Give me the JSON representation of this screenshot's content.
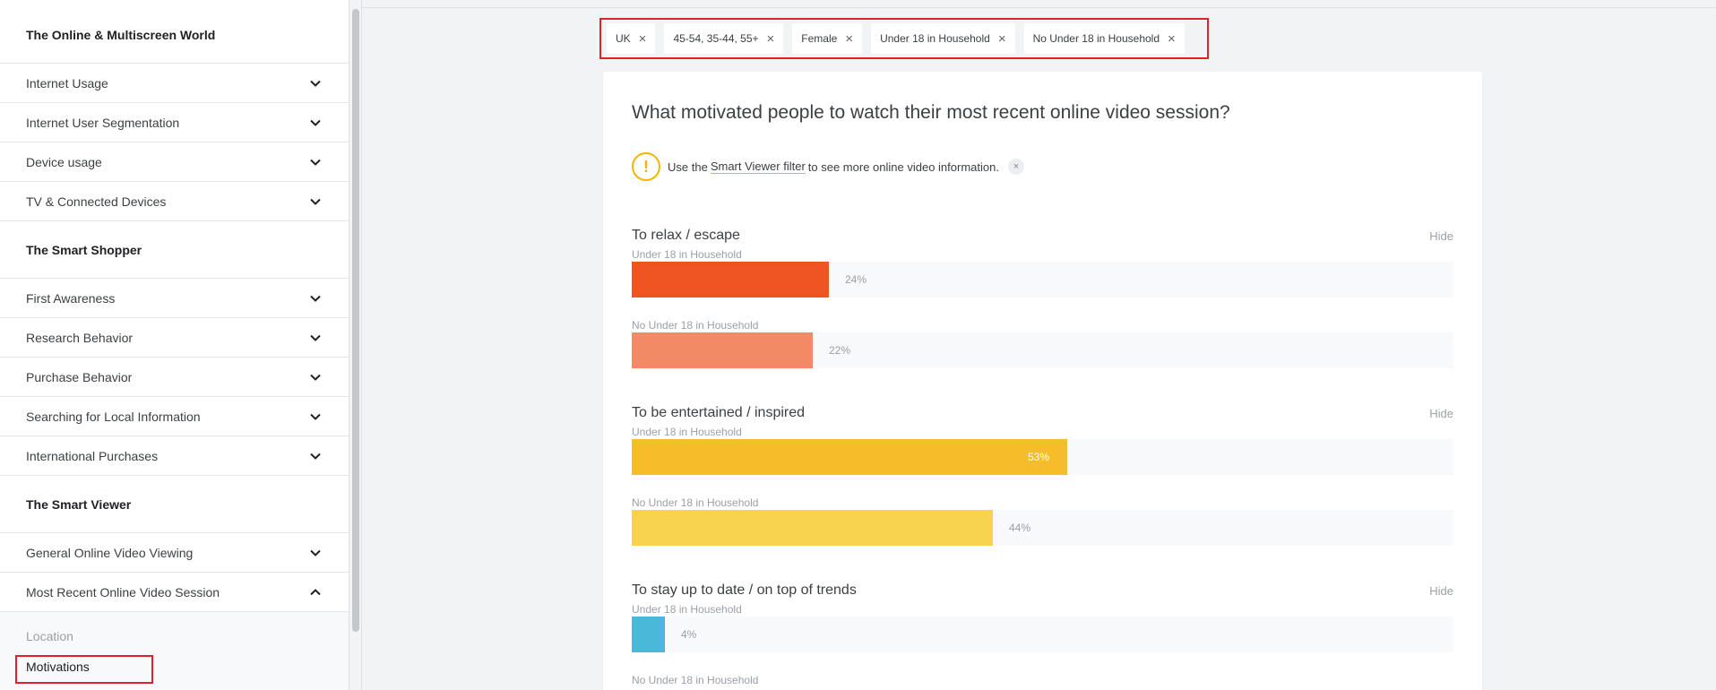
{
  "sidebar": {
    "sections": [
      {
        "title": "The Online & Multiscreen World",
        "items": [
          "Internet Usage",
          "Internet User Segmentation",
          "Device usage",
          "TV & Connected Devices"
        ]
      },
      {
        "title": "The Smart Shopper",
        "items": [
          "First Awareness",
          "Research Behavior",
          "Purchase Behavior",
          "Searching for Local Information",
          "International Purchases"
        ]
      },
      {
        "title": "The Smart Viewer",
        "items": [
          "General Online Video Viewing",
          "Most Recent Online Video Session"
        ]
      }
    ],
    "sub_items": [
      "Location",
      "Motivations"
    ],
    "active_sub_item": "Motivations"
  },
  "filters": [
    "UK",
    "45-54, 35-44, 55+",
    "Female",
    "Under 18 in Household",
    "No Under 18 in Household"
  ],
  "card": {
    "title": "What motivated people to watch their most recent online video session?",
    "notice": {
      "prefix": "Use the",
      "link": "Smart Viewer filter",
      "suffix": "to see more online video information.",
      "dismiss": "×"
    },
    "hide_label": "Hide"
  },
  "chart_data": {
    "type": "bar",
    "orientation": "horizontal",
    "unit": "%",
    "xlim": [
      0,
      100
    ],
    "groups": [
      {
        "title": "To relax / escape",
        "rows": [
          {
            "label": "Under 18 in Household",
            "value": 24,
            "color": "#ee5522"
          },
          {
            "label": "No Under 18 in Household",
            "value": 22,
            "color": "#f28b65"
          }
        ]
      },
      {
        "title": "To be entertained / inspired",
        "rows": [
          {
            "label": "Under 18 in Household",
            "value": 53,
            "color": "#f5bd2a"
          },
          {
            "label": "No Under 18 in Household",
            "value": 44,
            "color": "#f7d34f"
          }
        ]
      },
      {
        "title": "To stay up to date / on top of trends",
        "rows": [
          {
            "label": "Under 18 in Household",
            "value": 4,
            "color": "#4ab8d9"
          },
          {
            "label": "No Under 18 in Household"
          }
        ]
      }
    ]
  }
}
